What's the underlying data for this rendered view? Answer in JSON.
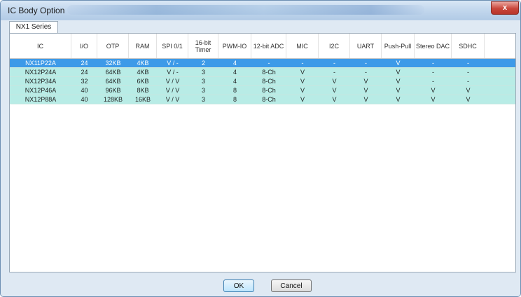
{
  "window": {
    "title": "IC Body Option",
    "close_label": "x"
  },
  "tab": {
    "label": "NX1 Series"
  },
  "table": {
    "columns": [
      {
        "key": "ic",
        "label": "IC"
      },
      {
        "key": "io",
        "label": "I/O"
      },
      {
        "key": "otp",
        "label": "OTP"
      },
      {
        "key": "ram",
        "label": "RAM"
      },
      {
        "key": "spi",
        "label": "SPI 0/1"
      },
      {
        "key": "timer",
        "label": "16-bit Timer"
      },
      {
        "key": "pwm",
        "label": "PWM-IO"
      },
      {
        "key": "adc",
        "label": "12-bit ADC"
      },
      {
        "key": "mic",
        "label": "MIC"
      },
      {
        "key": "i2c",
        "label": "I2C"
      },
      {
        "key": "uart",
        "label": "UART"
      },
      {
        "key": "pushpull",
        "label": "Push-Pull"
      },
      {
        "key": "dac",
        "label": "Stereo DAC"
      },
      {
        "key": "sdhc",
        "label": "SDHC"
      }
    ],
    "selected_row": 0,
    "rows": [
      [
        "NX11P22A",
        "24",
        "32KB",
        "4KB",
        "V / -",
        "2",
        "4",
        "-",
        "-",
        "-",
        "-",
        "V",
        "-",
        "-"
      ],
      [
        "NX12P24A",
        "24",
        "64KB",
        "4KB",
        "V / -",
        "3",
        "4",
        "8-Ch",
        "V",
        "-",
        "-",
        "V",
        "-",
        "-"
      ],
      [
        "NX12P34A",
        "32",
        "64KB",
        "6KB",
        "V / V",
        "3",
        "4",
        "8-Ch",
        "V",
        "V",
        "V",
        "V",
        "-",
        "-"
      ],
      [
        "NX12P46A",
        "40",
        "96KB",
        "8KB",
        "V / V",
        "3",
        "8",
        "8-Ch",
        "V",
        "V",
        "V",
        "V",
        "V",
        "V"
      ],
      [
        "NX12P88A",
        "40",
        "128KB",
        "16KB",
        "V / V",
        "3",
        "8",
        "8-Ch",
        "V",
        "V",
        "V",
        "V",
        "V",
        "V"
      ]
    ]
  },
  "buttons": {
    "ok_label": "OK",
    "cancel_label": "Cancel"
  },
  "colors": {
    "row_normal": "#b8ece6",
    "row_selected": "#3d9ae8"
  }
}
